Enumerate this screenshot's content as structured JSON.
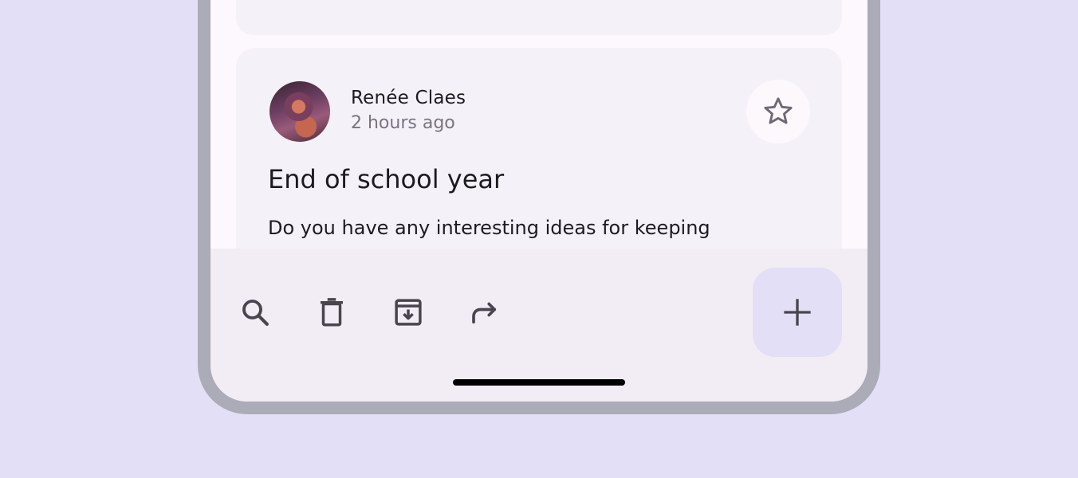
{
  "post": {
    "author": "Renée Claes",
    "time": "2 hours ago",
    "title": "End of school year",
    "body": "Do you have any interesting ideas for keeping"
  },
  "icons": {
    "avatar": "avatar-photo",
    "favorite": "star-outline-icon",
    "search": "search-icon",
    "delete": "trash-icon",
    "archive": "archive-icon",
    "forward": "forward-arrow-icon",
    "compose": "plus-icon"
  },
  "colors": {
    "background": "#e2dff6",
    "frame": "#acabb8",
    "surface": "#fdf7fe",
    "card": "#f5f1f8",
    "bottom_bar": "#f2ecf4",
    "fab": "#e2dff6",
    "icon": "#49454f"
  }
}
